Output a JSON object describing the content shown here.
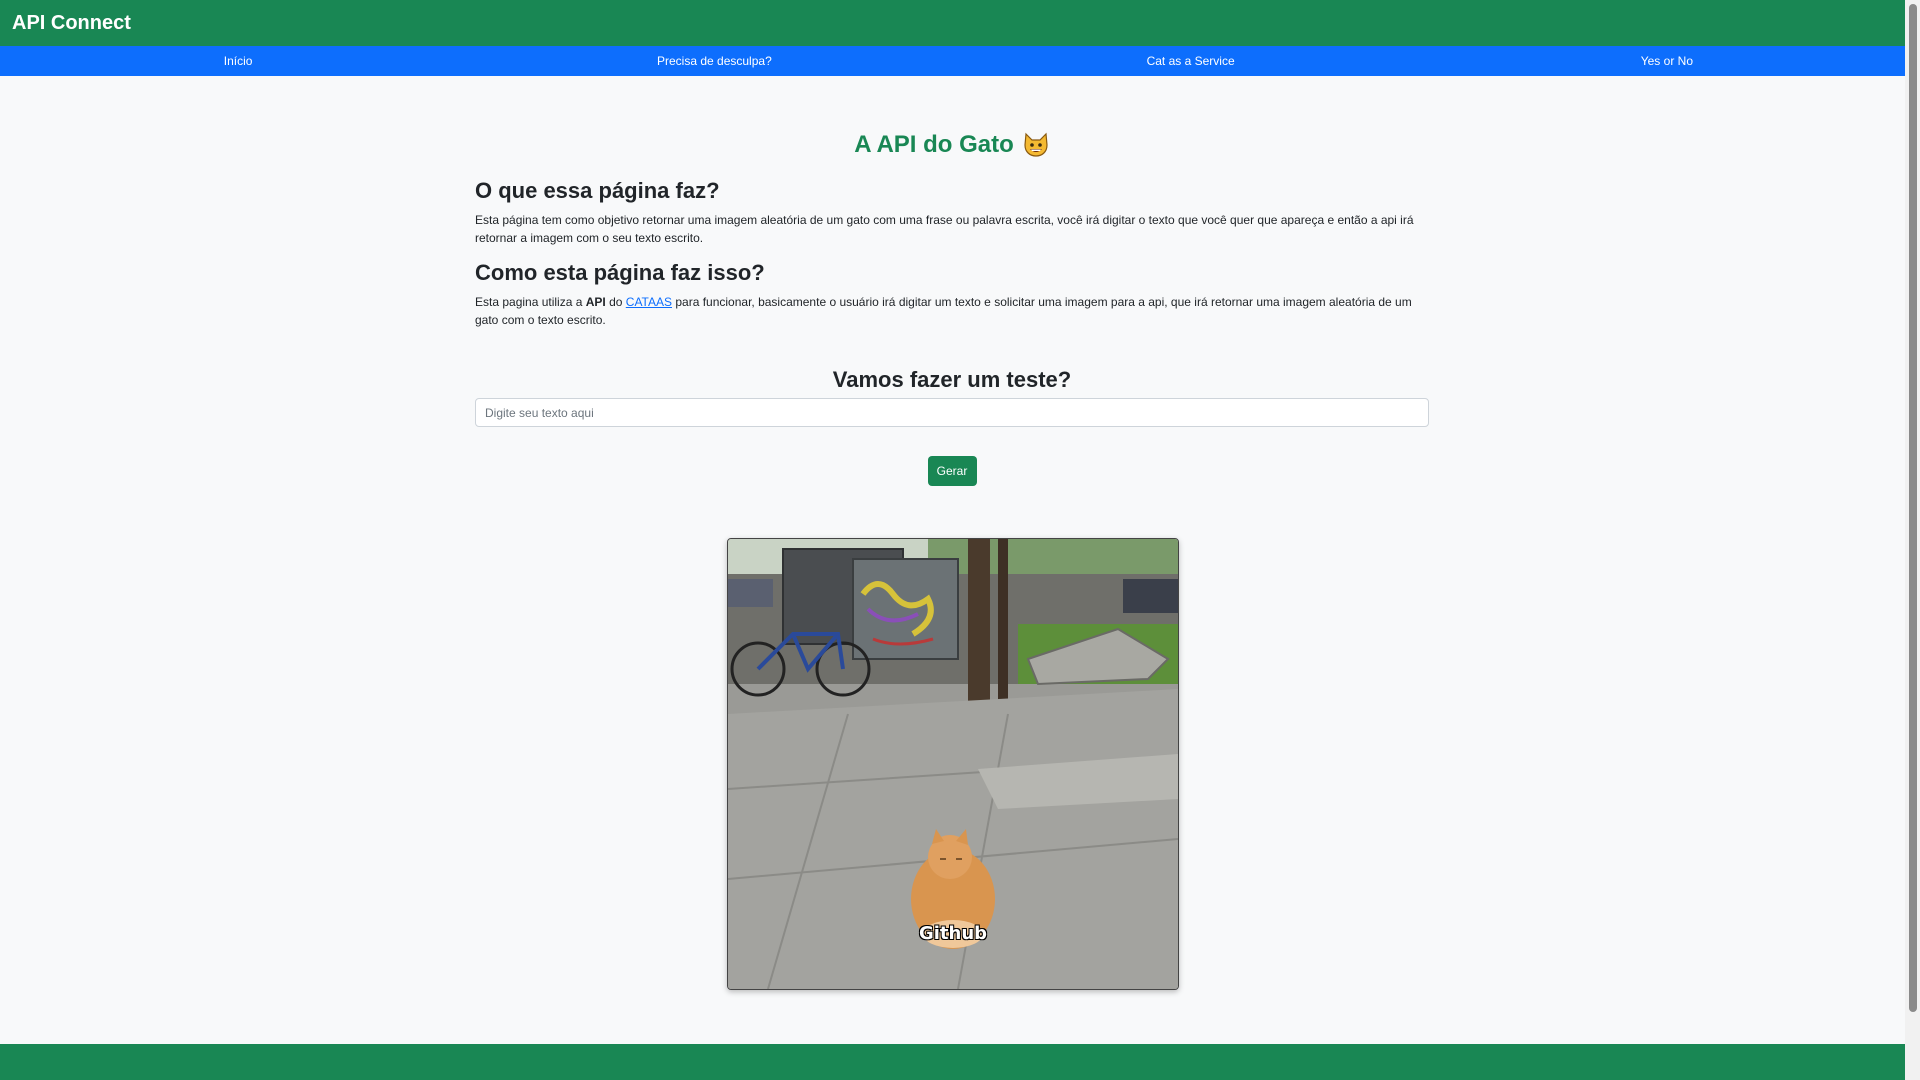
{
  "header": {
    "brand": "API Connect"
  },
  "nav": {
    "items": [
      {
        "label": "Início"
      },
      {
        "label": "Precisa de desculpa?"
      },
      {
        "label": "Cat as a Service"
      },
      {
        "label": "Yes or No"
      }
    ]
  },
  "main": {
    "title": "A API do Gato",
    "title_icon": "grinning-cat-emoji",
    "section1": {
      "heading": "O que essa página faz?",
      "text": "Esta página tem como objetivo retornar uma imagem aleatória de um gato com uma frase ou palavra escrita, você irá digitar o texto que você quer que apareça e então a api irá retornar a imagem com o seu texto escrito."
    },
    "section2": {
      "heading": "Como esta página faz isso?",
      "text_before": "Esta pagina utiliza a ",
      "api_bold": "API",
      "text_do": " do ",
      "link": "CATAAS",
      "text_after": " para funcionar, basicamente o usuário irá digitar um texto e solicitar uma imagem para a api, que irá retornar uma imagem aleatória de um gato com o texto escrito."
    },
    "test": {
      "heading": "Vamos fazer um teste?",
      "input_placeholder": "Digite seu texto aqui",
      "input_value": "",
      "button": "Gerar"
    },
    "result_image": {
      "caption": "Github",
      "colors": {
        "sky": "#c9d3c5",
        "pavement": "#9a9a96",
        "cat": "#d9954f",
        "grass": "#5d8f3a"
      }
    }
  },
  "colors": {
    "green": "#198754",
    "blue": "#0d6efd"
  }
}
